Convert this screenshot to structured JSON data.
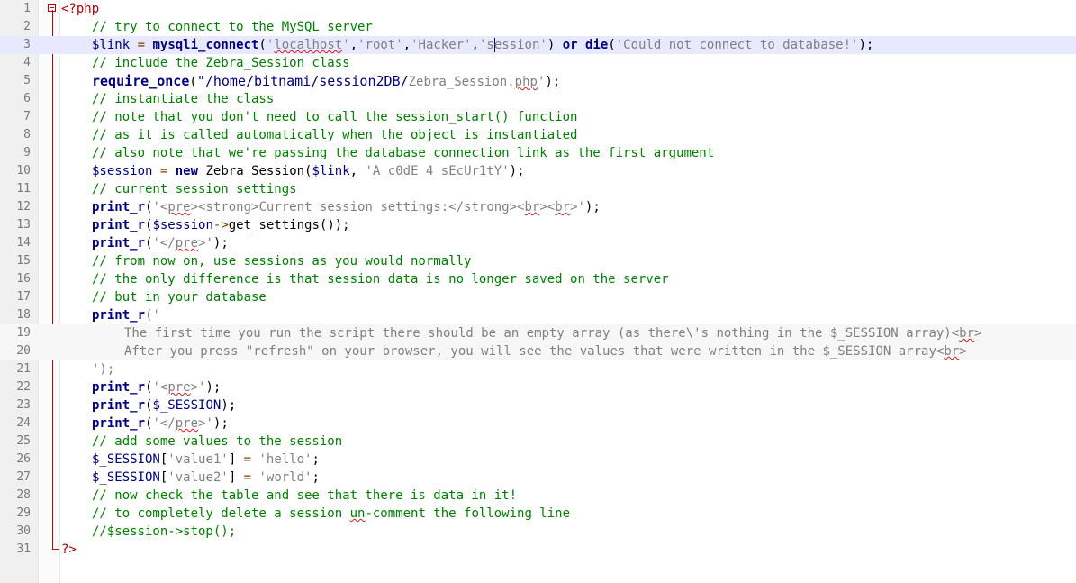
{
  "editor": {
    "language": "php",
    "current_line": 3,
    "lines": [
      {
        "n": "1",
        "text": "<?php"
      },
      {
        "n": "2",
        "text": "// try to connect to the MySQL server"
      },
      {
        "n": "3",
        "text": "$link = mysqli_connect('localhost','root','Hacker','session') or die('Could not connect to database!');"
      },
      {
        "n": "4",
        "text": "// include the Zebra_Session class"
      },
      {
        "n": "5",
        "text": "require_once(\"/home/bitnami/session2DB/Zebra_Session.php');"
      },
      {
        "n": "6",
        "text": "// instantiate the class"
      },
      {
        "n": "7",
        "text": "// note that you don't need to call the session_start() function"
      },
      {
        "n": "8",
        "text": "// as it is called automatically when the object is instantiated"
      },
      {
        "n": "9",
        "text": "// also note that we're passing the database connection link as the first argument"
      },
      {
        "n": "10",
        "text": "$session = new Zebra_Session($link, 'A_c0dE_4_sEcUr1tY');"
      },
      {
        "n": "11",
        "text": "// current session settings"
      },
      {
        "n": "12",
        "text": "print_r('<pre><strong>Current session settings:</strong><br><br>');"
      },
      {
        "n": "13",
        "text": "print_r($session->get_settings());"
      },
      {
        "n": "14",
        "text": "print_r('</pre>');"
      },
      {
        "n": "15",
        "text": "// from now on, use sessions as you would normally"
      },
      {
        "n": "16",
        "text": "// the only difference is that session data is no longer saved on the server"
      },
      {
        "n": "17",
        "text": "// but in your database"
      },
      {
        "n": "18",
        "text": "print_r('"
      },
      {
        "n": "19",
        "text": "The first time you run the script there should be an empty array (as there\\'s nothing in the $_SESSION array)<br>"
      },
      {
        "n": "20",
        "text": "After you press \"refresh\" on your browser, you will see the values that were written in the $_SESSION array<br>"
      },
      {
        "n": "21",
        "text": "');"
      },
      {
        "n": "22",
        "text": "print_r('<pre>');"
      },
      {
        "n": "23",
        "text": "print_r($_SESSION);"
      },
      {
        "n": "24",
        "text": "print_r('</pre>');"
      },
      {
        "n": "25",
        "text": "// add some values to the session"
      },
      {
        "n": "26",
        "text": "$_SESSION['value1'] = 'hello';"
      },
      {
        "n": "27",
        "text": "$_SESSION['value2'] = 'world';"
      },
      {
        "n": "28",
        "text": "// now check the table and see that there is data in it!"
      },
      {
        "n": "29",
        "text": "// to completely delete a session un-comment the following line"
      },
      {
        "n": "30",
        "text": "//$session->stop();"
      },
      {
        "n": "31",
        "text": "?>"
      }
    ]
  },
  "colors": {
    "comment": "#008000",
    "keyword": "#000080",
    "string": "#808080",
    "php_tag": "#b00000",
    "current_line_bg": "#e8e8ff"
  }
}
